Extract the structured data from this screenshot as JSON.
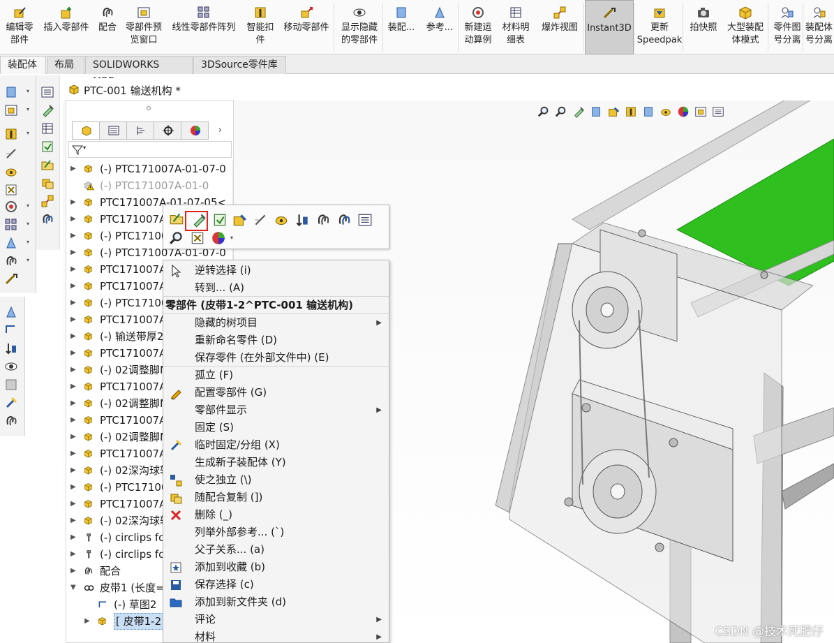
{
  "ribbon": {
    "buttons": [
      {
        "label": "编辑零\n部件",
        "icon": "edit-component-icon"
      },
      {
        "label": "插入零部件",
        "icon": "insert-component-icon"
      },
      {
        "label": "配合",
        "icon": "mate-icon"
      },
      {
        "label": "零部件预\n览窗口",
        "icon": "component-preview-icon"
      },
      {
        "label": "线性零部件阵列",
        "icon": "linear-pattern-icon"
      },
      {
        "label": "智能扣\n件",
        "icon": "smart-fastener-icon"
      },
      {
        "label": "移动零部件",
        "icon": "move-component-icon"
      },
      {
        "label": "显示隐藏\n的零部件",
        "icon": "show-hidden-icon"
      },
      {
        "label": "装配...",
        "icon": "assembly-feature-icon"
      },
      {
        "label": "参考...",
        "icon": "reference-geometry-icon"
      },
      {
        "label": "新建运\n动算例",
        "icon": "new-motion-study-icon"
      },
      {
        "label": "材料明\n细表",
        "icon": "bom-icon"
      },
      {
        "label": "爆炸视图",
        "icon": "exploded-view-icon"
      },
      {
        "label": "Instant3D",
        "icon": "instant3d-icon"
      },
      {
        "label": "更新\nSpeedpak",
        "icon": "speedpak-icon"
      },
      {
        "label": "拍快照",
        "icon": "snapshot-icon"
      },
      {
        "label": "大型装配\n体模式",
        "icon": "large-assembly-icon"
      },
      {
        "label": "零件图\n号分离",
        "icon": "part-number-icon"
      },
      {
        "label": "装配体\n号分离",
        "icon": "assembly-number-icon"
      }
    ]
  },
  "tabs": [
    "装配体",
    "布局",
    "SOLIDWORKS MBD",
    "3DSource零件库"
  ],
  "document": {
    "title": "PTC-001 输送机构 *"
  },
  "tree": {
    "items": [
      {
        "label": "(-) PTC171007A-01-07-0",
        "type": "part",
        "exp": "▶"
      },
      {
        "label": "(-) PTC171007A-01-0",
        "type": "warn",
        "exp": ""
      },
      {
        "label": "PTC171007A-01-07-05<",
        "type": "part",
        "exp": "▶"
      },
      {
        "label": "PTC171007A",
        "type": "part",
        "exp": "▶"
      },
      {
        "label": "(-) PTC17100",
        "type": "part",
        "exp": "▶"
      },
      {
        "label": "(-) PTC171007A-01-07-0",
        "type": "part",
        "exp": "▶"
      },
      {
        "label": "PTC171007A",
        "type": "part",
        "exp": "▶"
      },
      {
        "label": "PTC171007A",
        "type": "part",
        "exp": "▶"
      },
      {
        "label": "(-) PTC17100",
        "type": "part",
        "exp": "▶"
      },
      {
        "label": "PTC171007A",
        "type": "part",
        "exp": "▶"
      },
      {
        "label": "(-) 输送带厚2",
        "type": "part",
        "exp": "▶"
      },
      {
        "label": "PTC171007A",
        "type": "part",
        "exp": "▶"
      },
      {
        "label": "(-) 02调整脚M",
        "type": "part",
        "exp": "▶"
      },
      {
        "label": "PTC171007A",
        "type": "part",
        "exp": "▶"
      },
      {
        "label": "(-) 02调整脚M",
        "type": "part",
        "exp": "▶"
      },
      {
        "label": "PTC171007A",
        "type": "part",
        "exp": "▶"
      },
      {
        "label": "(-) 02调整脚M",
        "type": "part",
        "exp": "▶"
      },
      {
        "label": "PTC171007A",
        "type": "part",
        "exp": "▶"
      },
      {
        "label": "(-) 02深沟球轴",
        "type": "part",
        "exp": "▶"
      },
      {
        "label": "(-) PTC17100",
        "type": "part",
        "exp": "▶"
      },
      {
        "label": "PTC171007A",
        "type": "part",
        "exp": "▶"
      },
      {
        "label": "(-) 02深沟球轴",
        "type": "part",
        "exp": "▶"
      },
      {
        "label": "(-) circlips fo",
        "type": "screw",
        "exp": "▶"
      },
      {
        "label": "(-) circlips fo",
        "type": "screw",
        "exp": "▶"
      },
      {
        "label": "配合",
        "type": "mate",
        "exp": "▶"
      },
      {
        "label": "皮带1 (长度=",
        "type": "belt",
        "exp": "▼"
      },
      {
        "label": "(-) 草图2",
        "type": "sketch",
        "exp": ""
      },
      {
        "label": "[ 皮带1-2^",
        "type": "part",
        "exp": "▶"
      }
    ]
  },
  "context_toolbar": {
    "icons": [
      "open-part-icon",
      "edit-part-icon",
      "component-properties-icon",
      "appearance-icon",
      "hide-component-icon",
      "suppress-icon",
      "move-icon",
      "mate-icon",
      "mate-reference-icon",
      "properties-icon",
      "zoom-to-selection-icon",
      "isolate-icon",
      "color-palette-icon"
    ]
  },
  "context_menu": {
    "items": [
      {
        "label": "逆转选择 (i)",
        "icon": "cursor-icon",
        "submenu": false
      },
      {
        "label": "转到... (A)",
        "icon": "",
        "submenu": false
      },
      {
        "label": "零部件 (皮带1-2^PTC-001 输送机构)",
        "icon": "",
        "submenu": false,
        "header": true
      },
      {
        "label": "隐藏的树项目",
        "icon": "",
        "submenu": true
      },
      {
        "label": "重新命名零件 (D)",
        "icon": "",
        "submenu": false
      },
      {
        "label": "保存零件 (在外部文件中) (E)",
        "icon": "",
        "submenu": false
      },
      {
        "label": "孤立 (F)",
        "icon": "",
        "submenu": false
      },
      {
        "label": "配置零部件 (G)",
        "icon": "pencil-icon",
        "submenu": false
      },
      {
        "label": "零部件显示",
        "icon": "",
        "submenu": true
      },
      {
        "label": "固定 (S)",
        "icon": "",
        "submenu": false
      },
      {
        "label": "临时固定/分组 (X)",
        "icon": "temp-fix-icon",
        "submenu": false
      },
      {
        "label": "生成新子装配体 (Y)",
        "icon": "",
        "submenu": false
      },
      {
        "label": "使之独立 (\\)",
        "icon": "make-independent-icon",
        "submenu": false
      },
      {
        "label": "随配合复制 (])",
        "icon": "copy-with-mates-icon",
        "submenu": false
      },
      {
        "label": "删除 (_)",
        "icon": "delete-icon",
        "submenu": false
      },
      {
        "label": "列举外部参考... (`)",
        "icon": "",
        "submenu": false
      },
      {
        "label": "父子关系... (a)",
        "icon": "",
        "submenu": false
      },
      {
        "label": "添加到收藏 (b)",
        "icon": "favorite-icon",
        "submenu": false
      },
      {
        "label": "保存选择 (c)",
        "icon": "save-selection-icon",
        "submenu": false
      },
      {
        "label": "添加到新文件夹 (d)",
        "icon": "folder-icon",
        "submenu": false
      },
      {
        "label": "评论",
        "icon": "",
        "submenu": true
      },
      {
        "label": "材料",
        "icon": "",
        "submenu": true
      }
    ]
  },
  "watermark": "CSDN @技术死肥仔",
  "colors": {
    "belt_green": "#2fbf1f",
    "highlight_red": "#e0201a",
    "selection_blue": "#c9dff5"
  }
}
